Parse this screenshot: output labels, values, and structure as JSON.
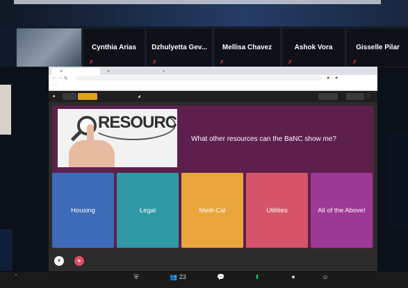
{
  "participants": [
    {
      "name": ""
    },
    {
      "name": "Cynthia Arias"
    },
    {
      "name": "Dzhulyetta  Gev..."
    },
    {
      "name": "Mellisa Chavez"
    },
    {
      "name": "Ashok Vora"
    },
    {
      "name": "Gisselle Pilar"
    }
  ],
  "slide": {
    "image_word": "RESOURCES",
    "question": "What other resources can the BaNC show me?",
    "options": [
      {
        "label": "Housing",
        "color": "#3d6bb8"
      },
      {
        "label": "Legal",
        "color": "#2f9aa5"
      },
      {
        "label": "Medi-Cal",
        "color": "#eaa53d"
      },
      {
        "label": "Utilities",
        "color": "#d55469"
      },
      {
        "label": "All of the Above!",
        "color": "#9c3896"
      }
    ]
  },
  "zoom_toolbar": {
    "participants_count": "23"
  },
  "colors": {
    "slide_bg": "#5d1f4c",
    "share_green": "#26c66b",
    "mic_muted": "#e23b3b"
  }
}
